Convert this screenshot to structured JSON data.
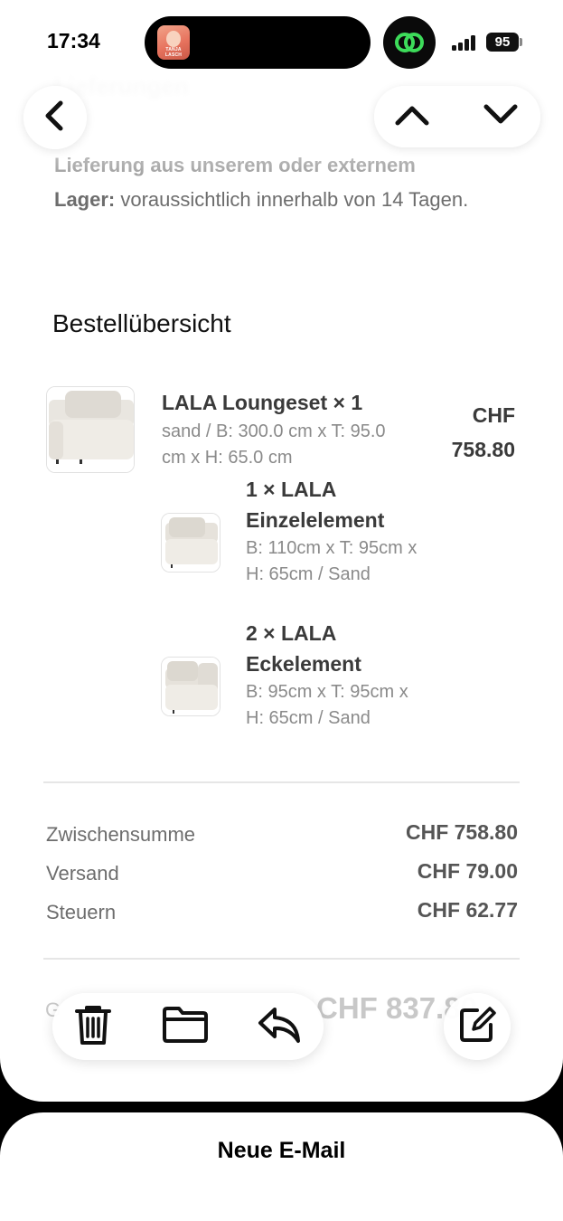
{
  "status_bar": {
    "time": "17:34",
    "battery": "95",
    "island_thumb_text": "TANJA LASCH"
  },
  "nav": {
    "blurred_heading": "Lieferungen",
    "back_icon": "chevron-left-icon",
    "up_icon": "chevron-up-icon",
    "down_icon": "chevron-down-icon"
  },
  "delivery": {
    "bold_line1": "Lieferung aus unserem oder externem",
    "bold_line2": "Lager:",
    "text": " voraussichtlich innerhalb von 14 Tagen."
  },
  "order": {
    "section_title": "Bestellübersicht",
    "main_item": {
      "title": "LALA Loungeset × 1",
      "details": "sand / B: 300.0 cm x T: 95.0 cm x H: 65.0 cm",
      "price_currency": "CHF",
      "price_amount": "758.80"
    },
    "sub_items": [
      {
        "title": "1 × LALA Einzelelement",
        "details": "B: 110cm x T: 95cm x H: 65cm / Sand"
      },
      {
        "title": "2 × LALA Eckelement",
        "details": "B: 95cm x T: 95cm x H: 65cm / Sand"
      }
    ]
  },
  "summary": {
    "subtotal_label": "Zwischensumme",
    "subtotal_value": "CHF 758.80",
    "shipping_label": "Versand",
    "shipping_value": "CHF 79.00",
    "tax_label": "Steuern",
    "tax_value": "CHF 62.77",
    "total_label": "G",
    "total_value": "CHF 837.80"
  },
  "toolbar": {
    "trash_icon": "trash-icon",
    "folder_icon": "folder-icon",
    "reply_icon": "reply-icon",
    "compose_icon": "compose-icon"
  },
  "sheet": {
    "title": "Neue E-Mail"
  }
}
